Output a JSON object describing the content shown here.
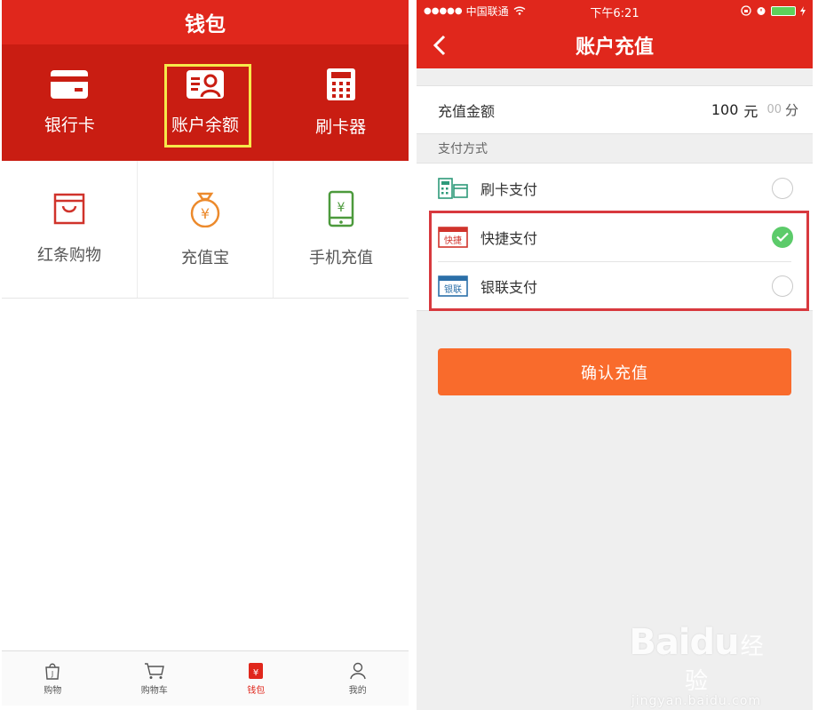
{
  "left": {
    "title": "钱包",
    "top_items": [
      {
        "label": "银行卡",
        "icon": "bank-card-icon"
      },
      {
        "label": "账户余额",
        "icon": "account-balance-icon",
        "highlighted": true
      },
      {
        "label": "刷卡器",
        "icon": "card-reader-icon"
      }
    ],
    "grid_items": [
      {
        "label": "红条购物",
        "icon": "shopping-bag-icon"
      },
      {
        "label": "充值宝",
        "icon": "money-bag-icon"
      },
      {
        "label": "手机充值",
        "icon": "phone-topup-icon"
      }
    ],
    "tabs": [
      {
        "label": "购物",
        "icon": "shopping-icon"
      },
      {
        "label": "购物车",
        "icon": "cart-icon"
      },
      {
        "label": "钱包",
        "icon": "wallet-icon",
        "active": true
      },
      {
        "label": "我的",
        "icon": "profile-icon"
      }
    ]
  },
  "right": {
    "status": {
      "signal": "●●●●●",
      "carrier": "中国联通",
      "time": "下午6:21"
    },
    "nav_title": "账户充值",
    "amount": {
      "label": "充值金额",
      "value": "100",
      "unit": "元",
      "fen_value": "00",
      "fen_unit": "分"
    },
    "pay_section_label": "支付方式",
    "pay_methods": [
      {
        "label": "刷卡支付",
        "icon": "card-reader-pay-icon",
        "selected": false
      },
      {
        "label": "快捷支付",
        "icon": "quick-pay-icon",
        "icon_text": "快捷",
        "selected": true
      },
      {
        "label": "银联支付",
        "icon": "unionpay-icon",
        "icon_text": "银联",
        "selected": false
      }
    ],
    "confirm_label": "确认充值"
  },
  "watermark": {
    "brand": "Baidu",
    "brand_cn": "经验",
    "url": "jingyan.baidu.com"
  },
  "colors": {
    "primary_red": "#e0271c",
    "dark_red": "#c91d12",
    "orange": "#f96b2c",
    "check_green": "#5ccb6a",
    "highlight_yellow": "#f6e94a",
    "frame_red": "#d8393e"
  }
}
